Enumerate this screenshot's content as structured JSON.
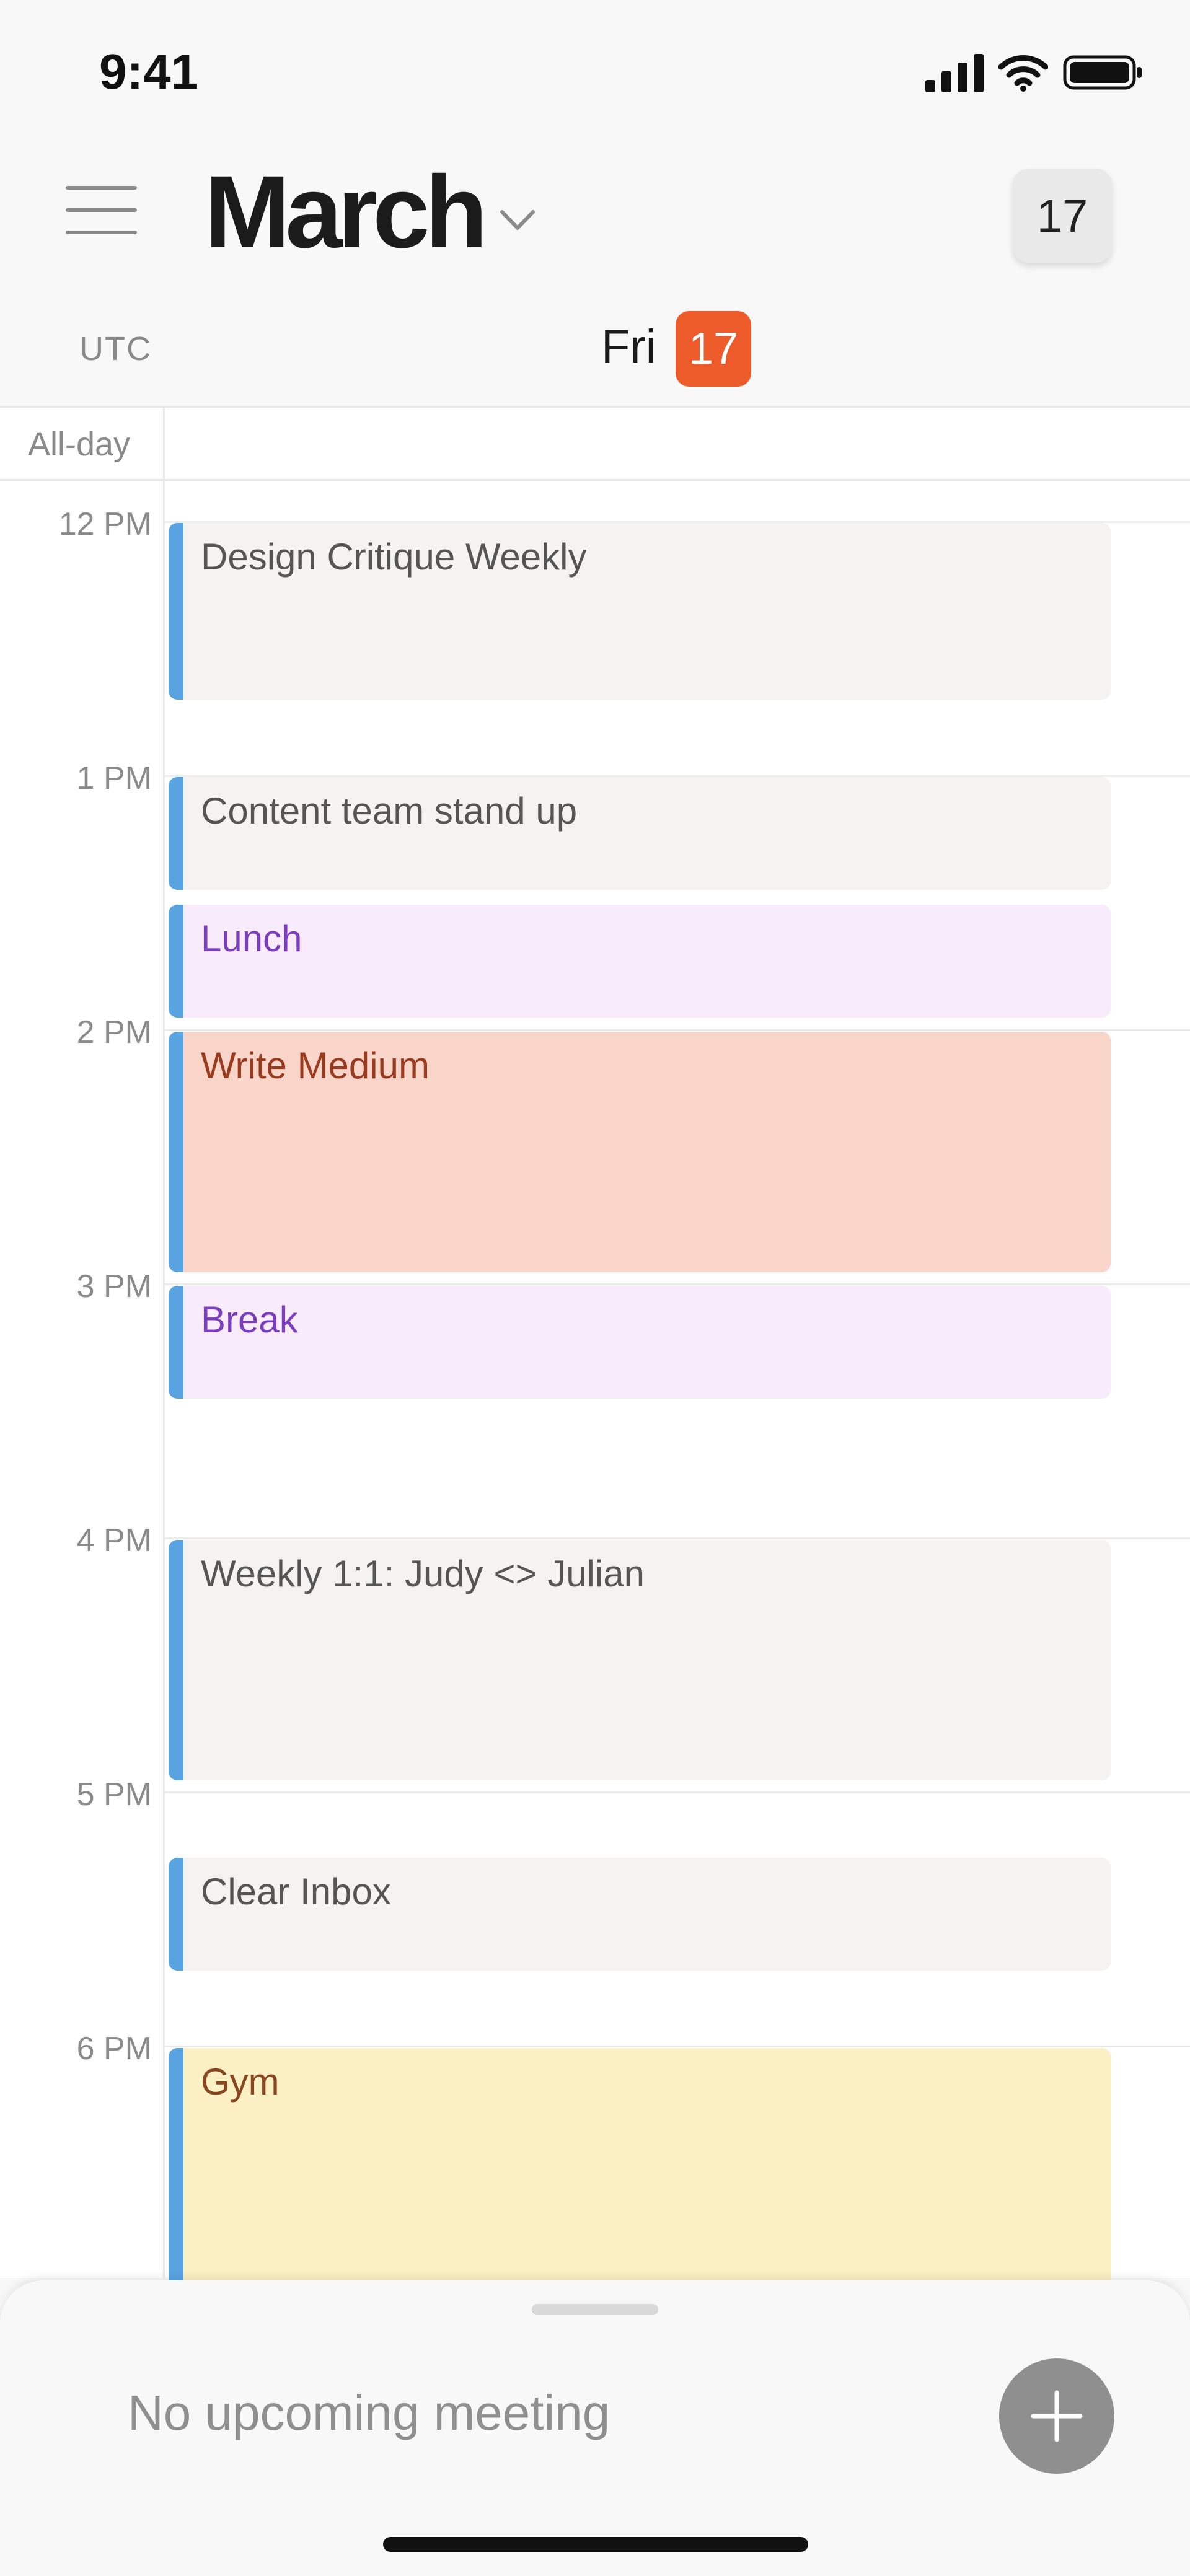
{
  "status_bar": {
    "time": "9:41",
    "icons": [
      "cellular-signal-icon",
      "wifi-icon",
      "battery-icon"
    ]
  },
  "header": {
    "month": "March",
    "today_button": "17",
    "icons": [
      "menu-icon",
      "chevron-down-icon"
    ]
  },
  "day_header": {
    "timezone": "UTC",
    "day_name": "Fri",
    "day_number": "17",
    "accent_color": "#ee5b2a"
  },
  "all_day": {
    "label": "All-day"
  },
  "hours": [
    "12 PM",
    "1 PM",
    "2 PM",
    "3 PM",
    "4 PM",
    "5 PM",
    "6 PM"
  ],
  "events": [
    {
      "title": "Design Critique Weekly"
    },
    {
      "title": "Content team stand up"
    },
    {
      "title": "Lunch"
    },
    {
      "title": "Write Medium"
    },
    {
      "title": "Break"
    },
    {
      "title": "Weekly 1:1: Judy <> Julian"
    },
    {
      "title": "Clear Inbox"
    },
    {
      "title": "Gym"
    }
  ],
  "bottom_sheet": {
    "upcoming_text": "No upcoming meeting",
    "icons": [
      "plus-icon"
    ]
  },
  "colors": {
    "event_accent": "#58a3e0",
    "neutral_event": "#f4f3f2",
    "purple_event": "#f8ebfb",
    "orange_event": "#f8d5c8",
    "yellow_event": "#fbefc4"
  }
}
